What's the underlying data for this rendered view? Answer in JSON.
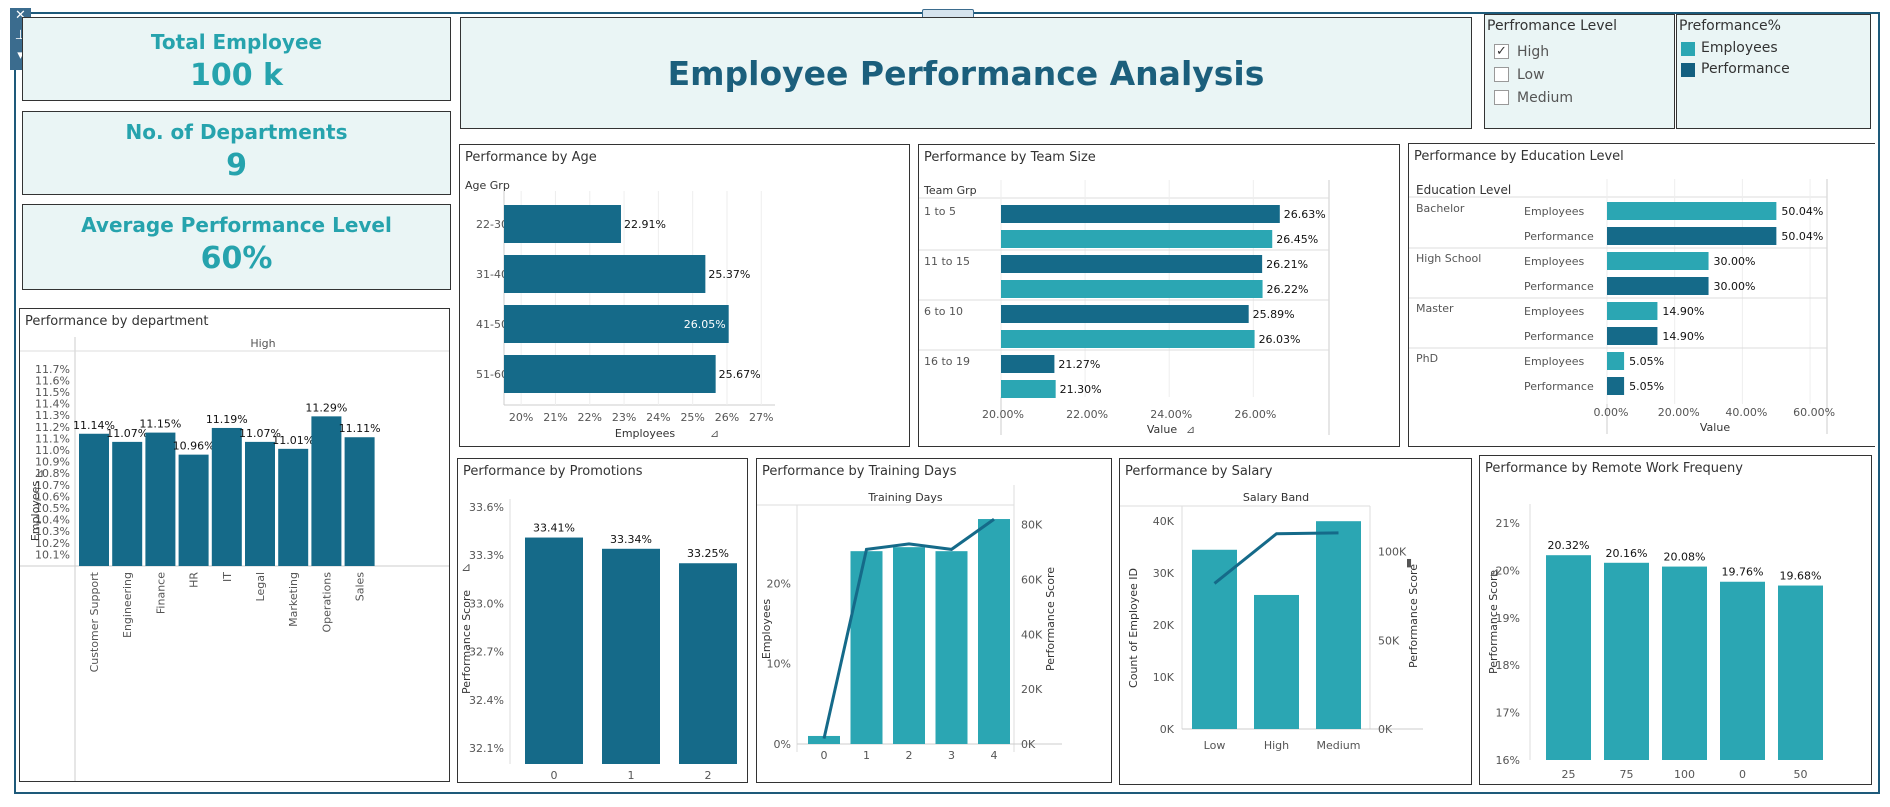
{
  "kpis": [
    {
      "label": "Total Employee",
      "value": "100 k"
    },
    {
      "label": "No. of Departments",
      "value": "9"
    },
    {
      "label": "Average Performance Level",
      "value": "60%"
    }
  ],
  "dashboard_title": "Employee Performance Analysis",
  "filter": {
    "title": "Perfromance Level",
    "options": [
      {
        "label": "High",
        "checked": true
      },
      {
        "label": "Low",
        "checked": false
      },
      {
        "label": "Medium",
        "checked": false
      }
    ]
  },
  "legend": {
    "title": "Preformance%",
    "items": [
      {
        "label": "Employees",
        "color": "#2ba6b3"
      },
      {
        "label": "Performance",
        "color": "#135f80"
      }
    ]
  },
  "colors": {
    "dark": "#156a89",
    "teal": "#2ba6b3",
    "accent": "#26a3ad",
    "title": "#1b5f7c"
  },
  "chart_data": [
    {
      "id": "dept",
      "type": "bar",
      "title": "Performance by department",
      "header": "High",
      "ylabel": "Employees",
      "categories": [
        "Customer Support",
        "Engineering",
        "Finance",
        "HR",
        "IT",
        "Legal",
        "Marketing",
        "Operations",
        "Sales"
      ],
      "values": [
        11.14,
        11.07,
        11.15,
        10.96,
        11.19,
        11.07,
        11.01,
        11.29,
        11.11
      ],
      "labels": [
        "11.14%",
        "11.07%",
        "11.15%",
        "10.96%",
        "11.19%",
        "11.07%",
        "11.01%",
        "11.29%",
        "11.11%"
      ],
      "ylim": [
        10.0,
        11.75
      ],
      "yticks": [
        "10.1%",
        "10.2%",
        "10.3%",
        "10.4%",
        "10.5%",
        "10.6%",
        "10.7%",
        "10.8%",
        "10.9%",
        "11.0%",
        "11.1%",
        "11.2%",
        "11.3%",
        "11.4%",
        "11.5%",
        "11.6%",
        "11.7%"
      ],
      "ytick_values": [
        10.1,
        10.2,
        10.3,
        10.4,
        10.5,
        10.6,
        10.7,
        10.8,
        10.9,
        11.0,
        11.1,
        11.2,
        11.3,
        11.4,
        11.5,
        11.6,
        11.7
      ]
    },
    {
      "id": "age",
      "type": "bar",
      "orientation": "horizontal",
      "title": "Performance by Age",
      "category_header": "Age Grp",
      "categories": [
        "22-30",
        "31-40",
        "41-50",
        "51-60"
      ],
      "values": [
        22.91,
        25.37,
        26.05,
        25.67
      ],
      "labels": [
        "22.91%",
        "25.37%",
        "26.05%",
        "25.67%"
      ],
      "xlim": [
        19.5,
        27.4
      ],
      "xticks": [
        "20%",
        "21%",
        "22%",
        "23%",
        "24%",
        "25%",
        "26%",
        "27%"
      ],
      "xtick_values": [
        20,
        21,
        22,
        23,
        24,
        25,
        26,
        27
      ],
      "xlabel": "Employees"
    },
    {
      "id": "team",
      "type": "bar",
      "orientation": "horizontal",
      "title": "Performance by Team Size",
      "category_header": "Team Grp",
      "categories": [
        "1 to 5",
        "11 to 15",
        "6 to 10",
        "16 to 19"
      ],
      "series": [
        {
          "name": "Performance",
          "values": [
            26.63,
            26.21,
            25.89,
            21.27
          ],
          "labels": [
            "26.63%",
            "26.21%",
            "25.89%",
            "21.27%"
          ]
        },
        {
          "name": "Employees",
          "values": [
            26.45,
            26.22,
            26.03,
            21.3
          ],
          "labels": [
            "26.45%",
            "26.22%",
            "26.03%",
            "21.30%"
          ]
        }
      ],
      "xlim": [
        20.0,
        27.8
      ],
      "xticks": [
        "20.00%",
        "22.00%",
        "24.00%",
        "26.00%"
      ],
      "xtick_values": [
        20,
        22,
        24,
        26
      ],
      "xlabel": "Value"
    },
    {
      "id": "edu",
      "type": "bar",
      "orientation": "horizontal",
      "title": "Performance by Education Level",
      "category_header": "Education Level",
      "categories": [
        "Bachelor",
        "High School",
        "Master",
        "PhD"
      ],
      "measure_names": [
        "Employees",
        "Performance"
      ],
      "series": [
        {
          "name": "Employees",
          "values": [
            50.04,
            30.0,
            14.9,
            5.05
          ],
          "labels": [
            "50.04%",
            "30.00%",
            "14.90%",
            "5.05%"
          ]
        },
        {
          "name": "Performance",
          "values": [
            50.04,
            30.0,
            14.9,
            5.05
          ],
          "labels": [
            "50.04%",
            "30.00%",
            "14.90%",
            "5.05%"
          ]
        }
      ],
      "xlim": [
        0,
        65
      ],
      "xticks": [
        "0.00%",
        "20.00%",
        "40.00%",
        "60.00%"
      ],
      "xtick_values": [
        0,
        20,
        40,
        60
      ],
      "xlabel": "Value"
    },
    {
      "id": "promo",
      "type": "bar",
      "title": "Performance by Promotions",
      "ylabel": "Performance Score",
      "categories": [
        "0",
        "1",
        "2"
      ],
      "values": [
        33.41,
        33.34,
        33.25
      ],
      "labels": [
        "33.41%",
        "33.34%",
        "33.25%"
      ],
      "ylim": [
        32.0,
        33.65
      ],
      "yticks": [
        "32.1%",
        "32.4%",
        "32.7%",
        "33.0%",
        "33.3%",
        "33.6%"
      ],
      "ytick_values": [
        32.1,
        32.4,
        32.7,
        33.0,
        33.3,
        33.6
      ]
    },
    {
      "id": "training",
      "type": "bar",
      "title": "Performance by Training Days",
      "header": "Training Days",
      "ylabel": "Employees",
      "y2label": "Performance Score",
      "categories": [
        "0",
        "1",
        "2",
        "3",
        "4"
      ],
      "values": [
        1.0,
        24.0,
        24.5,
        24.0,
        28.0
      ],
      "line_values": [
        2000,
        71000,
        73000,
        71000,
        82000
      ],
      "ylim": [
        0,
        29
      ],
      "yticks": [
        "0%",
        "10%",
        "20%"
      ],
      "ytick_values": [
        0,
        10,
        20
      ],
      "y2lim": [
        0,
        85000
      ],
      "y2ticks": [
        "0K",
        "20K",
        "40K",
        "60K",
        "80K"
      ],
      "y2tick_values": [
        0,
        20000,
        40000,
        60000,
        80000
      ]
    },
    {
      "id": "salary",
      "type": "bar",
      "title": "Performance by Salary",
      "header": "Salary Band",
      "ylabel": "Count of Employee ID",
      "y2label": "Performance Score",
      "categories": [
        "Low",
        "High",
        "Medium"
      ],
      "values": [
        34500,
        25800,
        40000
      ],
      "line_values": [
        82000,
        110000,
        110500
      ],
      "ylim": [
        0,
        41000
      ],
      "yticks": [
        "0K",
        "10K",
        "20K",
        "30K",
        "40K"
      ],
      "ytick_values": [
        0,
        10000,
        20000,
        30000,
        40000
      ],
      "y2lim": [
        0,
        120000
      ],
      "y2ticks": [
        "0K",
        "50K",
        "100K"
      ],
      "y2tick_values": [
        0,
        50000,
        100000
      ]
    },
    {
      "id": "remote",
      "type": "bar",
      "title": "Performance by Remote Work Frequeny",
      "ylabel": "Performance Score",
      "categories": [
        "25",
        "75",
        "100",
        "0",
        "50"
      ],
      "values": [
        20.32,
        20.16,
        20.08,
        19.76,
        19.68
      ],
      "labels": [
        "20.32%",
        "20.16%",
        "20.08%",
        "19.76%",
        "19.68%"
      ],
      "ylim": [
        16.0,
        21.4
      ],
      "yticks": [
        "16%",
        "17%",
        "18%",
        "19%",
        "20%",
        "21%"
      ],
      "ytick_values": [
        16,
        17,
        18,
        19,
        20,
        21
      ]
    }
  ]
}
